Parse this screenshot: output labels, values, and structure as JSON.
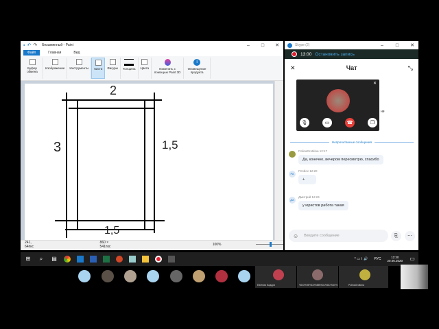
{
  "paint": {
    "title": "Безымянный - Paint",
    "tabs": [
      "Файл",
      "Главная",
      "Вид"
    ],
    "ribbon": [
      "Буфер обмена",
      "Изображение",
      "Инструменты",
      "Кисти",
      "Фигуры",
      "Толщина",
      "Цвета",
      "Изменить с помощью Paint 3D",
      "Оповещение продукта"
    ],
    "labels": {
      "top": "2",
      "left": "3",
      "right": "1,5",
      "bottom": "1,5"
    },
    "status": {
      "cursor": "241, 64пкс",
      "size": "860 × 541пкс",
      "zoom": "100%"
    }
  },
  "skype": {
    "title": "Skype (2)",
    "record_time": "13:00",
    "record_action": "Остановить запись",
    "chat_title": "Чат",
    "unread_divider": "Непрочитанные сообщения",
    "messages": [
      {
        "author": "PolinaGrotkina 12:17",
        "text": "Да, конечно, вечером пересмотрю, спасибо",
        "initials": ""
      },
      {
        "author": "Pesbov 12:20",
        "text": "+",
        "initials": "PA"
      },
      {
        "author": "Дмитрий 12:24",
        "text": "у юристов работа такая",
        "initials": "ДА"
      }
    ],
    "partial_text": "не",
    "input_placeholder": "Введите сообщение"
  },
  "taskbar": {
    "lang": "РУС",
    "time": "12:30",
    "date": "20.06.2020"
  },
  "participants": [
    "Евгения Бодари",
    "%D0%9E%D0%BB%D1%8C%D0%B3...",
    "PolinaGrotkina"
  ],
  "colors": {
    "accent": "#1979ca",
    "record": "#e02030",
    "end_call": "#e8403a"
  }
}
